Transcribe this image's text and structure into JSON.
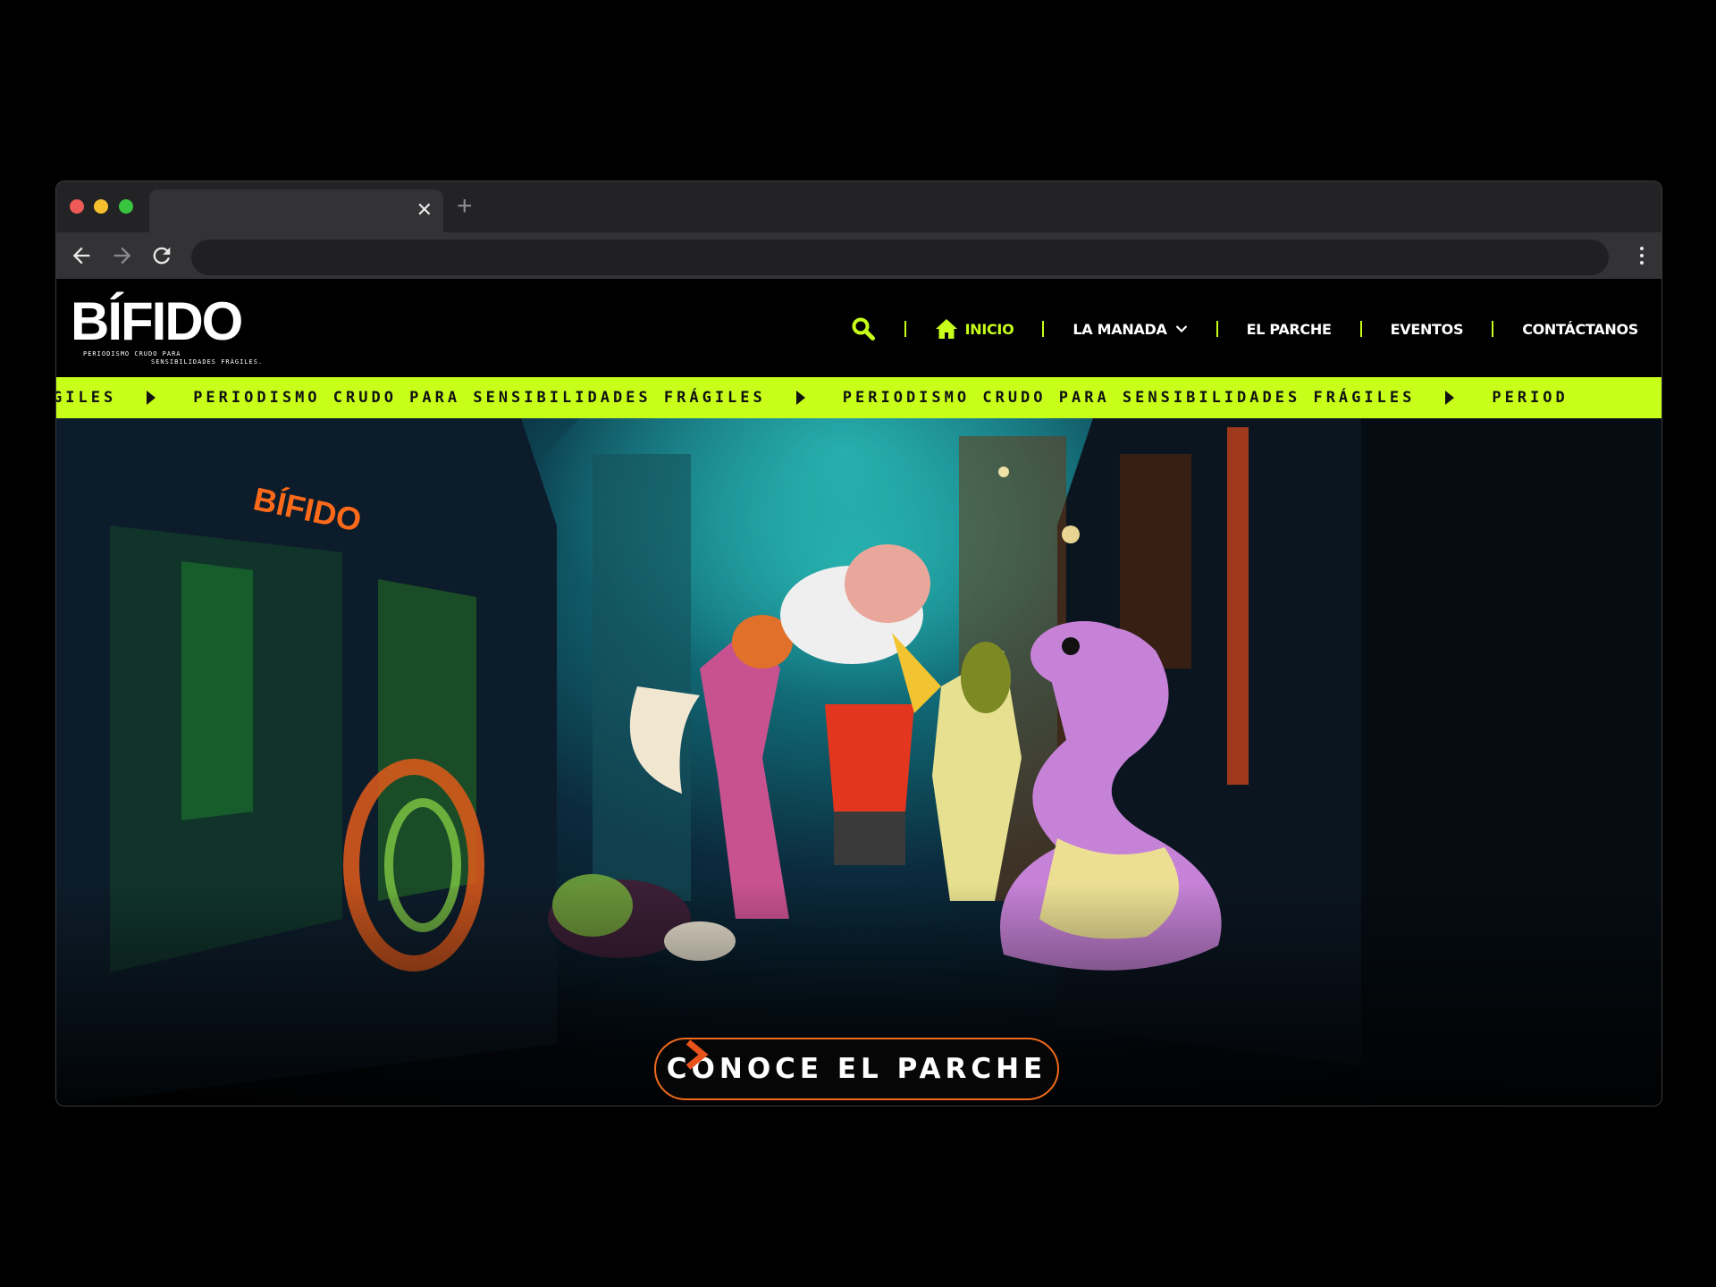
{
  "browser": {
    "tab_close": "✕",
    "new_tab": "+",
    "address": ""
  },
  "site": {
    "logo": {
      "word": "BÍFIDO",
      "tagline_1": "PERIODISMO CRUDO PARA",
      "tagline_2": "SENSIBILIDADES FRÁGILES."
    },
    "nav": {
      "search_icon": "search-icon",
      "home": "INICIO",
      "la_manada": "LA MANADA",
      "el_parche": "EL PARCHE",
      "eventos": "EVENTOS",
      "contactanos": "CONTÁCTANOS"
    },
    "ticker": {
      "tail": "GILES",
      "text": "PERIODISMO CRUDO PARA SENSIBILIDADES FRÁGILES",
      "text_2": "PERIODISMO CRUDO PARA SENSIBILIDADES FRÁGILES",
      "head": "PERIOD"
    },
    "hero": {
      "wall_sign": "BÍFIDO",
      "cta": "CONOCE EL PARCHE"
    }
  },
  "colors": {
    "accent": "#c7ff1a",
    "cta_border": "#f06a1d",
    "background": "#000000"
  }
}
